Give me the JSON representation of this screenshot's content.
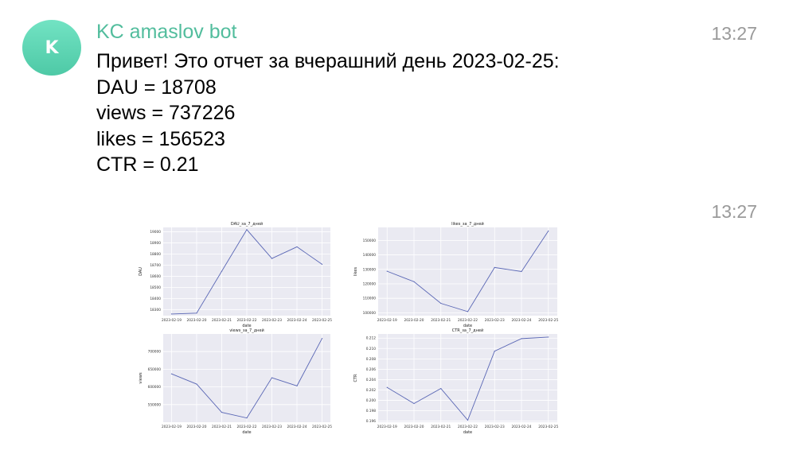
{
  "sender": {
    "name": "KC amaslov bot",
    "initial": "K"
  },
  "messages": [
    {
      "time": "13:27",
      "lines": [
        "Привет! Это отчет за вчерашний день 2023-02-25:",
        "DAU = 18708",
        "views = 737226",
        "likes = 156523",
        "CTR = 0.21"
      ]
    },
    {
      "time": "13:27"
    }
  ],
  "colors": {
    "avatar": "#5fd5b3",
    "sender": "#52bd9d",
    "time": "#9a9a9a",
    "line": "#5a67b5",
    "plot_bg": "#eaeaf2"
  },
  "chart_data": [
    {
      "type": "line",
      "title": "DAU_за_7_дней",
      "xlabel": "date",
      "ylabel": "DAU",
      "x": [
        "2023-02-19",
        "2023-02-20",
        "2023-02-21",
        "2023-02-22",
        "2023-02-23",
        "2023-02-24",
        "2023-02-25"
      ],
      "values": [
        18260,
        18268,
        18645,
        19020,
        18760,
        18865,
        18708
      ],
      "yticks": [
        18300,
        18400,
        18500,
        18600,
        18700,
        18800,
        18900,
        19000
      ],
      "ylim": [
        18245,
        19040
      ],
      "grid": true
    },
    {
      "type": "line",
      "title": "likes_за_7_дней",
      "xlabel": "date",
      "ylabel": "likes",
      "x": [
        "2023-02-19",
        "2023-02-20",
        "2023-02-21",
        "2023-02-22",
        "2023-02-23",
        "2023-02-24",
        "2023-02-25"
      ],
      "values": [
        128700,
        121500,
        106500,
        100800,
        131300,
        128500,
        156523
      ],
      "yticks": [
        100000,
        110000,
        120000,
        130000,
        140000,
        150000
      ],
      "ylim": [
        98000,
        159000
      ],
      "grid": true
    },
    {
      "type": "line",
      "title": "views_за_7_дней",
      "xlabel": "date",
      "ylabel": "views",
      "x": [
        "2023-02-19",
        "2023-02-20",
        "2023-02-21",
        "2023-02-22",
        "2023-02-23",
        "2023-02-24",
        "2023-02-25"
      ],
      "values": [
        637000,
        608000,
        528000,
        512000,
        626000,
        603000,
        737226
      ],
      "yticks": [
        550000,
        600000,
        650000,
        700000
      ],
      "ylim": [
        500000,
        750000
      ],
      "grid": true
    },
    {
      "type": "line",
      "title": "CTR_за_7_дней",
      "xlabel": "date",
      "ylabel": "CTR",
      "x": [
        "2023-02-19",
        "2023-02-20",
        "2023-02-21",
        "2023-02-22",
        "2023-02-23",
        "2023-02-24",
        "2023-02-25"
      ],
      "values": [
        0.2025,
        0.1994,
        0.2023,
        0.1962,
        0.2095,
        0.2119,
        0.2122
      ],
      "yticks": [
        0.196,
        0.198,
        0.2,
        0.202,
        0.204,
        0.206,
        0.208,
        0.21,
        0.212
      ],
      "ylim": [
        0.1958,
        0.2128
      ],
      "grid": true
    }
  ]
}
